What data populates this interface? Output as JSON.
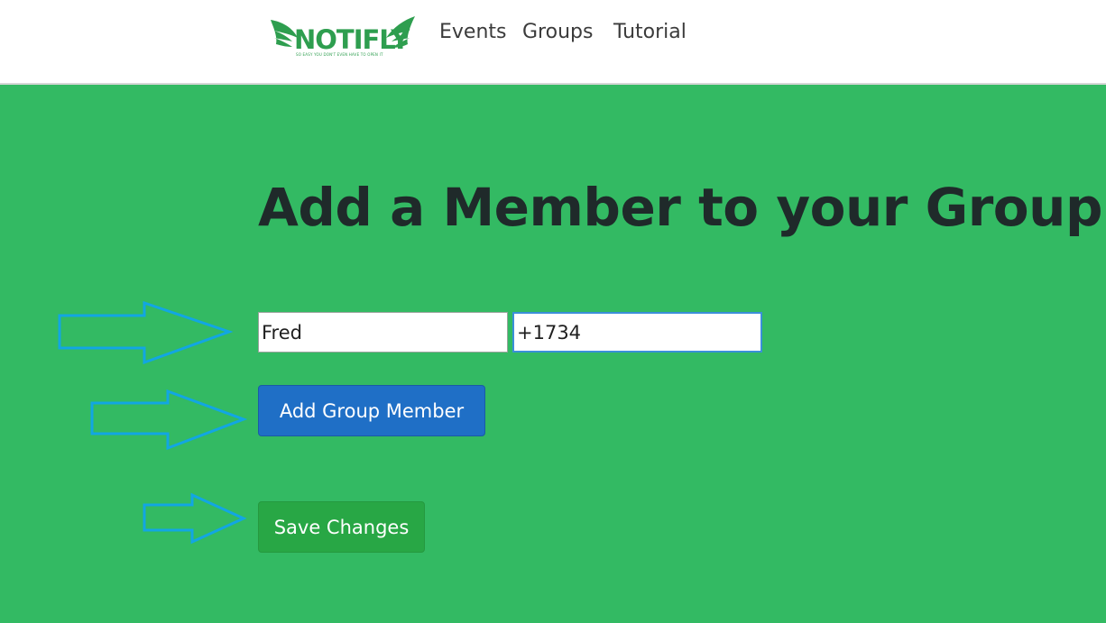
{
  "navbar": {
    "logo": {
      "text": "NOTIFLY",
      "tagline": "SO EASY YOU DON'T EVEN HAVE TO OPEN IT",
      "color": "#2e9e4f"
    },
    "links": [
      "Events",
      "Groups",
      "Tutorial"
    ]
  },
  "main": {
    "title": "Add a Member to your Group!",
    "name_input_value": "Fred",
    "phone_input_value": "+1734",
    "add_button_label": "Add Group Member",
    "save_button_label": "Save Changes"
  },
  "colors": {
    "background": "#33ba63",
    "add_button": "#1f6fc6",
    "save_button": "#28a745",
    "annotation_arrow": "#12a6e3"
  },
  "annotations": [
    "arrow-right-icon",
    "arrow-right-icon",
    "arrow-right-icon"
  ]
}
